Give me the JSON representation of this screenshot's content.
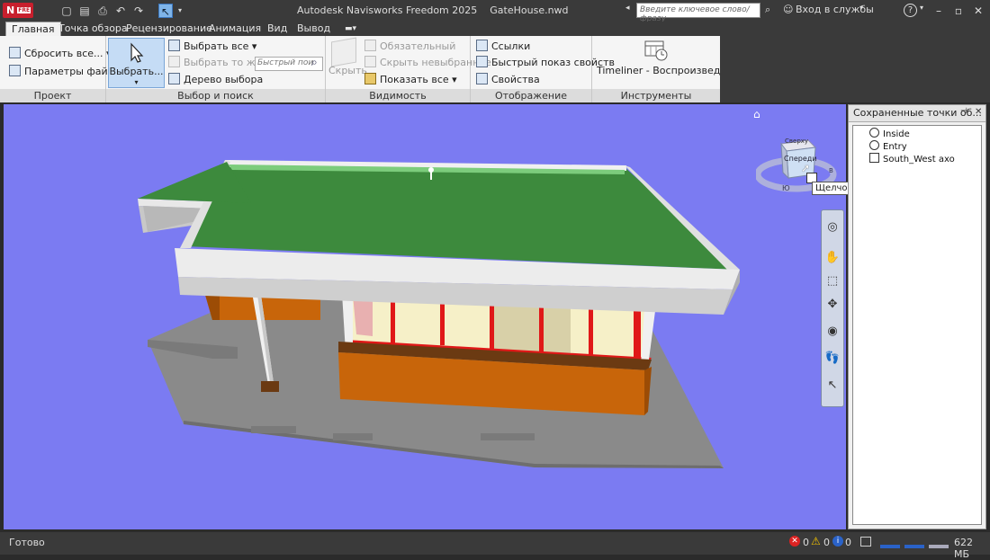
{
  "app": {
    "logo_text": "N",
    "logo_badge": "FRE",
    "title": "Autodesk Navisworks Freedom 2025",
    "file_name": "GateHouse.nwd",
    "search_placeholder": "Введите ключевое слово/фразу",
    "signin_label": "Вход в службы",
    "help_label": "?"
  },
  "tabs": [
    {
      "label": "Главная"
    },
    {
      "label": "Точка обзора"
    },
    {
      "label": "Рецензирование"
    },
    {
      "label": "Анимация"
    },
    {
      "label": "Вид"
    },
    {
      "label": "Вывод"
    }
  ],
  "ribbon": {
    "project": {
      "label": "Проект",
      "reset_all": "Сбросить все...",
      "file_options": "Параметры файла"
    },
    "select_search": {
      "label": "Выбор и поиск",
      "select": "Выбрать...",
      "select_all": "Выбрать все",
      "select_same": "Выбрать то же",
      "selection_tree": "Дерево выбора",
      "quick_find_placeholder": "Быстрый пои"
    },
    "visibility": {
      "label": "Видимость",
      "hide": "Скрыть",
      "require": "Обязательный",
      "hide_unselected": "Скрыть невыбранное",
      "unhide_all": "Показать все"
    },
    "display": {
      "label": "Отображение",
      "links": "Ссылки",
      "quick_properties": "Быстрый показ свойств",
      "properties": "Свойства"
    },
    "tools": {
      "label": "Инструменты",
      "timeliner": "Timeliner - Воспроизведение"
    }
  },
  "viewcube": {
    "top_label": "Сверху",
    "front_label": "Спереди",
    "compass_s": "Ю",
    "compass_e": "В",
    "tooltip": "Щелчок или перетаскивание"
  },
  "saved_viewpoints": {
    "title": "Сохраненные точки об...",
    "items": [
      {
        "label": "Inside",
        "icon": "viewpoint-perspective-icon"
      },
      {
        "label": "Entry",
        "icon": "viewpoint-perspective-icon"
      },
      {
        "label": "South_West axo",
        "icon": "viewpoint-orthographic-icon"
      }
    ]
  },
  "status": {
    "text": "Готово",
    "errors": "0",
    "warnings": "0",
    "info": "0",
    "memory": "622 МБ"
  },
  "colors": {
    "viewport_bg": "#7b7bf2",
    "roof_green": "#3d8a3d",
    "trim_white": "#f0f0f0",
    "wall_orange": "#c8650a",
    "window_red": "#e01818",
    "ground_gray": "#8a8a8a"
  }
}
